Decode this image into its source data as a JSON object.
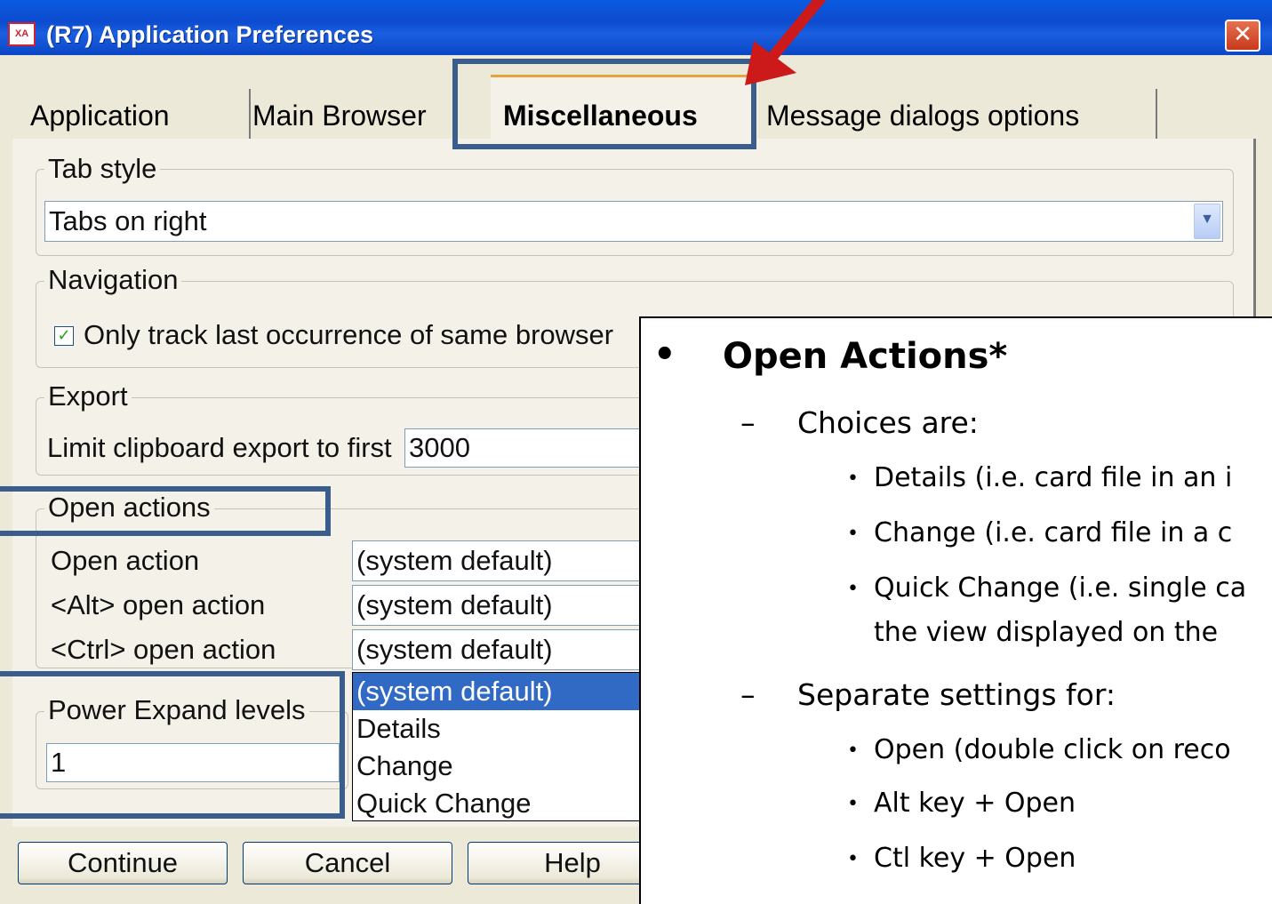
{
  "window": {
    "title": "(R7) Application Preferences",
    "icon_text": "XA",
    "close_glyph": "✕"
  },
  "tabs": [
    {
      "label": "Application"
    },
    {
      "label": "Main Browser"
    },
    {
      "label": "Miscellaneous",
      "active": true
    },
    {
      "label": "Message dialogs options"
    }
  ],
  "groups": {
    "tab_style": {
      "legend": "Tab style",
      "value": "Tabs on right"
    },
    "navigation": {
      "legend": "Navigation",
      "checkbox_label": "Only track last occurrence of same browser",
      "checked": true,
      "check_glyph": "✓"
    },
    "export": {
      "legend": "Export",
      "label": "Limit clipboard export to first",
      "value": "3000"
    },
    "open_actions": {
      "legend": "Open actions",
      "rows": [
        {
          "label": "Open action",
          "value": "(system default)"
        },
        {
          "label": "<Alt> open action",
          "value": "(system default)"
        },
        {
          "label": "<Ctrl> open action",
          "value": "(system default)"
        }
      ],
      "dropdown_options": [
        "(system default)",
        "Details",
        "Change",
        "Quick Change"
      ],
      "dropdown_selected": "(system default)"
    },
    "power_expand": {
      "legend": "Power Expand levels",
      "value": "1"
    }
  },
  "buttons": {
    "continue": "Continue",
    "cancel": "Cancel",
    "help": "Help"
  },
  "callout": {
    "heading": "Open Actions*",
    "choices_label": "Choices are:",
    "choices": [
      "Details (i.e. card file in an i",
      "Change (i.e. card file in a c",
      "Quick Change (i.e. single ca",
      "the view displayed on the"
    ],
    "settings_label": "Separate settings for:",
    "settings": [
      "Open  (double click on reco",
      "Alt key + Open",
      "Ctl key + Open"
    ],
    "bullet": "•",
    "dash": "–"
  },
  "colors": {
    "highlight": "#3b5d8c",
    "pointer_arrow": "#cc1a1a",
    "title_bar": "#0d4bcf",
    "selection": "#316ac5"
  }
}
